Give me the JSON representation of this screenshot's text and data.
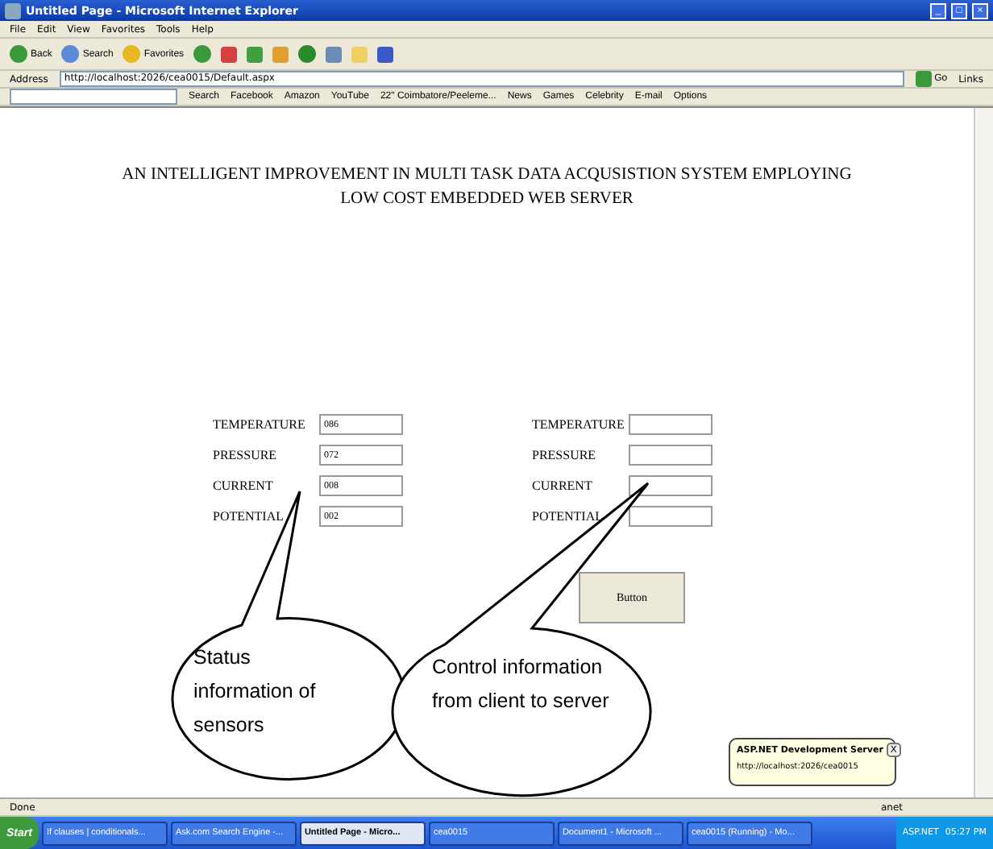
{
  "window": {
    "title": "Untitled Page - Microsoft Internet Explorer",
    "controls": [
      "_",
      "□",
      "×"
    ]
  },
  "menu": [
    "File",
    "Edit",
    "View",
    "Favorites",
    "Tools",
    "Help"
  ],
  "toolbar": [
    "Back",
    "Search",
    "Favorites"
  ],
  "address": {
    "label": "Address",
    "url": "http://localhost:2026/cea0015/Default.aspx",
    "go": "Go",
    "links": "Links"
  },
  "links_bar": {
    "search": "Search",
    "links": [
      "Facebook",
      "Amazon",
      "YouTube",
      "22\" Coimbatore/Peeleme...",
      "News",
      "Games",
      "Celebrity",
      "E-mail"
    ],
    "options": "Options"
  },
  "page": {
    "heading": "AN INTELLIGENT IMPROVEMENT IN MULTI TASK DATA ACQUSISTION SYSTEM EMPLOYING LOW COST EMBEDDED WEB SERVER",
    "status_fields": [
      {
        "label": "TEMPERATURE",
        "value": "086"
      },
      {
        "label": "PRESSURE",
        "value": "072"
      },
      {
        "label": "CURRENT",
        "value": "008"
      },
      {
        "label": "POTENTIAL",
        "value": "002"
      }
    ],
    "control_fields": [
      {
        "label": "TEMPERATURE"
      },
      {
        "label": "PRESSURE"
      },
      {
        "label": "CURRENT"
      },
      {
        "label": "POTENTIAL"
      }
    ],
    "button": "Button"
  },
  "callouts": [
    "Status information of sensors",
    "Control information from client to server"
  ],
  "balloon": {
    "title": "ASP.NET Development Server",
    "close": "X",
    "url": "http://localhost:2026/cea0015"
  },
  "status_bar": {
    "text": "Done",
    "zone": "anet"
  },
  "taskbar": {
    "start": "Start",
    "tasks": [
      {
        "label": "If clauses | conditionals...",
        "selected": false
      },
      {
        "label": "Ask.com Search Engine -...",
        "selected": false
      },
      {
        "label": "Untitled Page - Micro...",
        "selected": true
      },
      {
        "label": "cea0015",
        "selected": false
      },
      {
        "label": "Document1 - Microsoft ...",
        "selected": false
      },
      {
        "label": "cea0015 (Running) - Mo...",
        "selected": false
      }
    ],
    "tray": "ASP.NET",
    "clock": "05:27 PM"
  }
}
